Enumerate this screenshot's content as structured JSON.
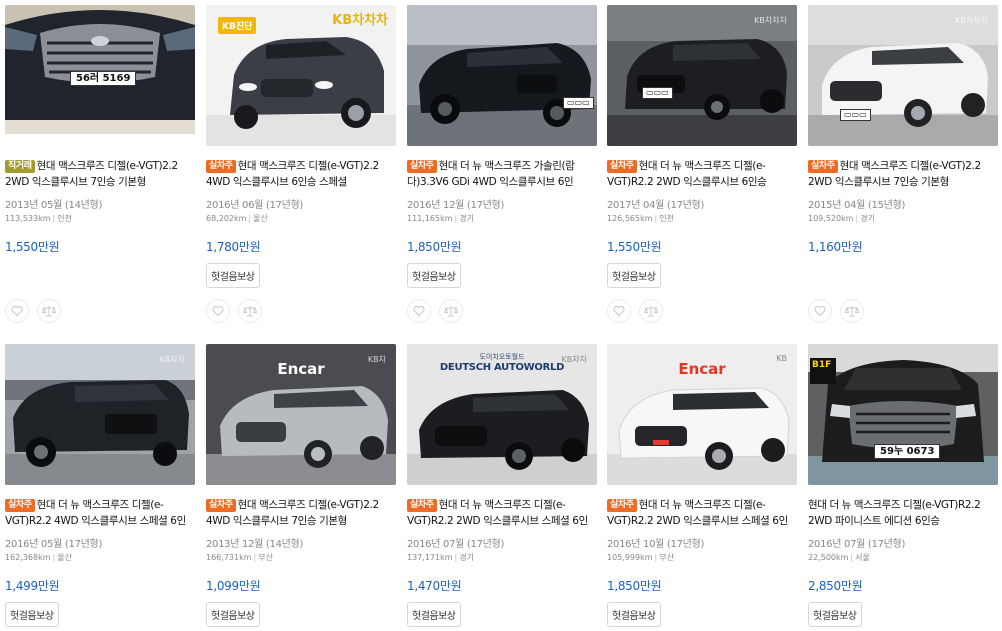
{
  "listings": [
    {
      "badge": "직거래",
      "title": "현대 맥스크루즈 디젤(e-VGT)2.2 2WD 익스클루시브 7인승 기본형",
      "year": "2013년 05월 (14년형)",
      "mileage": "113,533km",
      "region": "인천",
      "price": "1,550만원",
      "plate": "56러 5169"
    },
    {
      "badge": "실차주",
      "title": "현대 맥스크루즈 디젤(e-VGT)2.2 4WD 익스클루시브 6인승 스페셜",
      "year": "2016년 06월 (17년형)",
      "mileage": "68,202km",
      "region": "울산",
      "price": "1,780만원",
      "insurance": "헛걸음보상",
      "sticker": "KB진단",
      "kb_banner": "KB차차차"
    },
    {
      "badge": "실차주",
      "title": "현대 더 뉴 맥스크루즈 가솔린(람다)3.3V6 GDi 4WD 익스클루시브 6인",
      "year": "2016년 12월 (17년형)",
      "mileage": "111,165km",
      "region": "경기",
      "price": "1,850만원",
      "insurance": "헛걸음보상"
    },
    {
      "badge": "실차주",
      "title": "현대 더 뉴 맥스크루즈 디젤(e-VGT)R2.2 2WD 익스클루시브 6인승",
      "year": "2017년 04월 (17년형)",
      "mileage": "126,565km",
      "region": "인천",
      "price": "1,550만원",
      "insurance": "헛걸음보상",
      "kb_mark": "KB차차차"
    },
    {
      "badge": "실차주",
      "title": "현대 맥스크루즈 디젤(e-VGT)2.2 2WD 익스클루시브 7인승 기본형",
      "year": "2015년 04월 (15년형)",
      "mileage": "109,520km",
      "region": "경기",
      "price": "1,160만원",
      "kb_mark": "KB차차차"
    },
    {
      "badge": "실차주",
      "title": "현대 더 뉴 맥스크루즈 디젤(e-VGT)R2.2 4WD 익스클루시브 스페셜 6인승",
      "year": "2016년 05월 (17년형)",
      "mileage": "162,368km",
      "region": "울산",
      "price": "1,499만원",
      "insurance": "헛걸음보상",
      "kb_mark": "KB차차"
    },
    {
      "badge": "실차주",
      "title": "현대 맥스크루즈 디젤(e-VGT)2.2 4WD 익스클루시브 7인승 기본형",
      "year": "2013년 12월 (14년형)",
      "mileage": "166,731km",
      "region": "부산",
      "price": "1,099만원",
      "insurance": "헛걸음보상",
      "logo": "Encar",
      "kb_mark": "KB차"
    },
    {
      "badge": "실차주",
      "title": "현대 더 뉴 맥스크루즈 디젤(e-VGT)R2.2 2WD 익스클루시브 스페셜 6인승",
      "year": "2016년 07월 (17년형)",
      "mileage": "137,171km",
      "region": "경기",
      "price": "1,470만원",
      "insurance": "헛걸음보상",
      "dealer": "DEUTSCH AUTOWORLD",
      "dealer_sub": "도이치오토월드",
      "kb_mark": "KB차차"
    },
    {
      "badge": "실차주",
      "title": "현대 더 뉴 맥스크루즈 디젤(e-VGT)R2.2 2WD 익스클루시브 스페셜 6인승",
      "year": "2016년 10월 (17년형)",
      "mileage": "105,999km",
      "region": "부산",
      "price": "1,850만원",
      "insurance": "헛걸음보상",
      "logo": "Encar",
      "kb_mark": "KB"
    },
    {
      "title": "현대 더 뉴 맥스크루즈 디젤(e-VGT)R2.2 2WD 파이니스트 에디션 6인승",
      "year": "2016년 07월 (17년형)",
      "mileage": "22,500km",
      "region": "서울",
      "price": "2,850만원",
      "insurance": "헛걸음보상",
      "plate": "59누 0673",
      "sign": "B1F"
    }
  ],
  "colors": {
    "price": "#1c5fc2",
    "badge_owner": "#ef6a23",
    "badge_direct": "#a39b2c"
  },
  "icons": {
    "favorite": "heart-icon",
    "compare": "scale-icon"
  }
}
